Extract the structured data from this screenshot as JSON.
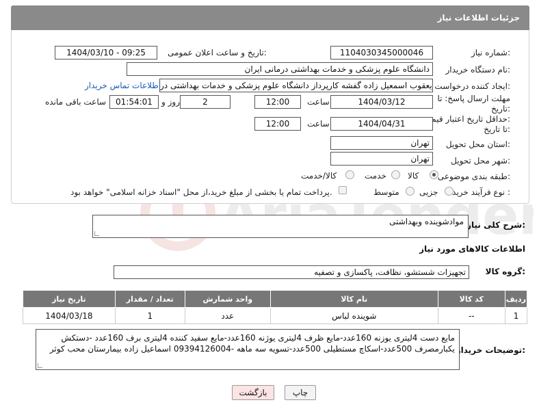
{
  "header": {
    "title": "جزئیات اطلاعات نیاز"
  },
  "form": {
    "need_number_label": "شماره نیاز:",
    "need_number": "1104030345000046",
    "announce_label": "تاریخ و ساعت اعلان عمومی:",
    "announce_value": "1404/03/10 - 09:25",
    "buyer_org_label": "نام دستگاه خریدار:",
    "buyer_org": "دانشگاه علوم پزشکی و خدمات بهداشتی درمانی ایران",
    "requester_label": "ایجاد کننده درخواست:",
    "requester": "یعقوب اسمعیل زاده گفشه کارپرداز دانشگاه علوم پزشکی و خدمات بهداشتی در",
    "contact_link": "اطلاعات تماس خریدار",
    "reply_deadline_label_1": "مهلت ارسال پاسخ: تا",
    "reply_deadline_label_2": "تاریخ:",
    "reply_date": "1404/03/12",
    "time_label": "ساعت",
    "reply_time": "12:00",
    "days_value": "2",
    "days_label": "روز و",
    "remaining_time": "01:54:01",
    "remaining_label": "ساعت باقی مانده",
    "price_deadline_label_1": "حداقل تاریخ اعتبار قیمت:",
    "price_deadline_label_2": "تا تاریخ:",
    "price_date": "1404/04/31",
    "price_time": "12:00",
    "province_label": "استان محل تحویل:",
    "province": "تهران",
    "city_label": "شهر محل تحویل:",
    "city": "تهران",
    "category_label": "طبقه بندی موضوعی:",
    "category_options": [
      "کالا",
      "خدمت",
      "کالا/خدمت"
    ],
    "category_selected": "کالا",
    "process_label": "نوع فرآیند خرید :",
    "process_options": [
      "جزیی",
      "متوسط"
    ],
    "process_note": "پرداخت تمام یا بخشی از مبلغ خرید،از محل \"اسناد خزانه اسلامی\" خواهد بود."
  },
  "description": {
    "label": "شرح کلی نیاز:",
    "value": "موادشوینده وبهداشتی"
  },
  "items_section": {
    "title": "اطلاعات کالاهای مورد نیاز",
    "group_label": "گروه کالا:",
    "group_value": "تجهیزات شستشو، نظافت، پاکسازی و تصفیه"
  },
  "table": {
    "headers": [
      "ردیف",
      "کد کالا",
      "نام کالا",
      "واحد شمارش",
      "تعداد / مقدار",
      "تاریخ نیاز"
    ],
    "rows": [
      [
        "1",
        "--",
        "شوینده لباس",
        "عدد",
        "1",
        "1404/03/18"
      ]
    ]
  },
  "buyer_notes": {
    "label": "توضیحات خریدار:",
    "line1": "مایع دست 4لیتری یوزنه 160عدد-مایع ظرف 4لیتری یوژنه 160عدد-مایع سفید کننده 4لیتری برف 160عدد -دستکش",
    "line2": "یکبارمصرف 500عدد-اسکاچ مستطیلی 500عدد-تسویه سه ماهه -09394126004 اسماعیل زاده بیمارستان محب کوثر"
  },
  "buttons": {
    "print": "چاپ",
    "back": "بازگشت"
  },
  "watermark": {
    "text": "AriaTender.neT"
  }
}
